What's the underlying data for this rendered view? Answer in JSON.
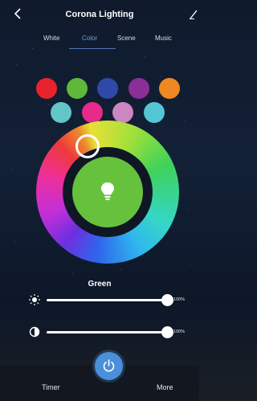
{
  "header": {
    "title": "Corona Lighting"
  },
  "tabs": [
    {
      "label": "White",
      "active": false
    },
    {
      "label": "Color",
      "active": true
    },
    {
      "label": "Scene",
      "active": false
    },
    {
      "label": "Music",
      "active": false
    }
  ],
  "presets": [
    {
      "name": "red",
      "color": "#e8232d"
    },
    {
      "name": "green",
      "color": "#5fb83a"
    },
    {
      "name": "blue",
      "color": "#2e49a7"
    },
    {
      "name": "purple",
      "color": "#8b2f96"
    },
    {
      "name": "orange",
      "color": "#ee8822"
    },
    {
      "name": "teal",
      "color": "#63c5c8"
    },
    {
      "name": "pink",
      "color": "#e62b8a"
    },
    {
      "name": "lavender",
      "color": "#cc86c2"
    },
    {
      "name": "cyan",
      "color": "#53c7d6"
    }
  ],
  "color_wheel": {
    "selected_color": "#66c23c"
  },
  "selected_color_name": "Green",
  "sliders": [
    {
      "name": "brightness",
      "icon": "sun-icon",
      "value_percent": 100,
      "label": "100%"
    },
    {
      "name": "saturation",
      "icon": "contrast-icon",
      "value_percent": 100,
      "label": "100%"
    }
  ],
  "bottom_bar": {
    "timer_label": "Timer",
    "more_label": "More",
    "power_color": "#4a8fd9"
  }
}
